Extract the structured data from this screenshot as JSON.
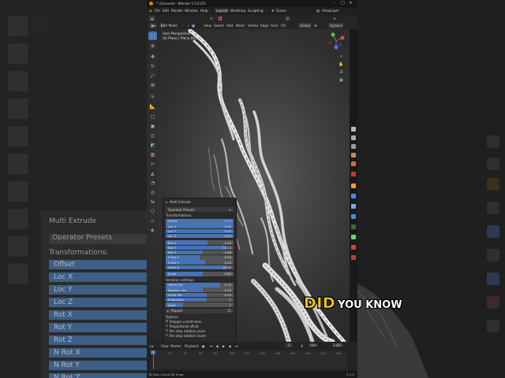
{
  "window": {
    "title": "* (Unsaved) - Blender 5.2.0 LTS",
    "menus": [
      "File",
      "Edit",
      "Render",
      "Window",
      "Help"
    ],
    "workspaces": [
      "Layout",
      "Modeling",
      "Sculpting"
    ],
    "active_workspace": "Layout",
    "scene": "Scene",
    "view_layer": "ViewLayer"
  },
  "header": {
    "mode": "Edit Mode",
    "menus": [
      "View",
      "Select",
      "Add",
      "Mesh",
      "Vertex",
      "Edge",
      "Face",
      "UV"
    ],
    "orientation": "Global",
    "options": "Options"
  },
  "viewport": {
    "line1": "User Perspective",
    "line2": "(0) Plane | Plane.001"
  },
  "operator": {
    "title": "Multi Extrude",
    "presets": "Operator Presets",
    "transformations_label": "Transformations:",
    "fields": [
      {
        "name": "Offset",
        "value": "0.77",
        "fill": 1.0
      },
      {
        "name": "Loc X",
        "value": "0.00",
        "fill": 1.0
      },
      {
        "name": "Loc Y",
        "value": "0.00",
        "fill": 1.0
      },
      {
        "name": "Loc Z",
        "value": "0.00",
        "fill": 1.0
      },
      {
        "name": "Rot X",
        "value": "-3.29",
        "fill": 0.62
      },
      {
        "name": "Rot Y",
        "value": "11.12",
        "fill": 0.9
      },
      {
        "name": "Rot Z",
        "value": "-4.88",
        "fill": 0.55
      },
      {
        "name": "N Rot X",
        "value": "-0.03",
        "fill": 0.5
      },
      {
        "name": "N Rot Y",
        "value": "-5.44",
        "fill": 0.58
      },
      {
        "name": "N Rot Z",
        "value": "10.00",
        "fill": 0.9
      },
      {
        "name": "Scale",
        "value": "0.89",
        "fill": 0.55
      }
    ],
    "variation_label": "Variation settings:",
    "variations": [
      {
        "name": "Offset Var",
        "value": "0.79",
        "fill": 0.8
      },
      {
        "name": "Rotation Var",
        "value": "-0.15",
        "fill": 0.55
      },
      {
        "name": "Scale Var",
        "value": "0.24",
        "fill": 0.6
      },
      {
        "name": "Probability",
        "value": "1",
        "fill": 0.6
      },
      {
        "name": "Seed",
        "value": "1",
        "fill": 0.25
      }
    ],
    "repeat": {
      "name": "Repeat",
      "value": "15"
    },
    "options_label": "Options:",
    "checkboxes": [
      {
        "label": "Polygon coordinates",
        "checked": true
      },
      {
        "label": "Proportional offset",
        "checked": false
      },
      {
        "label": "Per step rotation noise",
        "checked": false
      },
      {
        "label": "Per step rotation invert",
        "checked": false
      }
    ]
  },
  "timeline": {
    "menus": [
      "View",
      "Marker",
      "Playback"
    ],
    "current_frame": "1",
    "start_label": "Start",
    "start": "1",
    "end_label": "End",
    "end": "250",
    "ticks": [
      "0",
      "20",
      "40",
      "60",
      "80",
      "100",
      "120",
      "140",
      "160",
      "180",
      "200",
      "220",
      "240"
    ]
  },
  "status": {
    "left": "Box Constrain",
    "mid": "Snap",
    "version": "5.2.0"
  },
  "background": {
    "panel_title": "Multi Extrude",
    "presets": "Operator Presets",
    "transformations": "Transformations:",
    "rows": [
      "Offset",
      "Loc X",
      "Loc Y",
      "Loc Z",
      "Rot X",
      "Rot Y",
      "Rot Z",
      "N Rot X",
      "N Rot Y",
      "N Rot Z"
    ]
  },
  "caption": {
    "highlight": "DID",
    "rest": "YOU KNOW"
  },
  "colors": {
    "accent": "#4772b3",
    "caption_yellow": "#f3c51b"
  }
}
